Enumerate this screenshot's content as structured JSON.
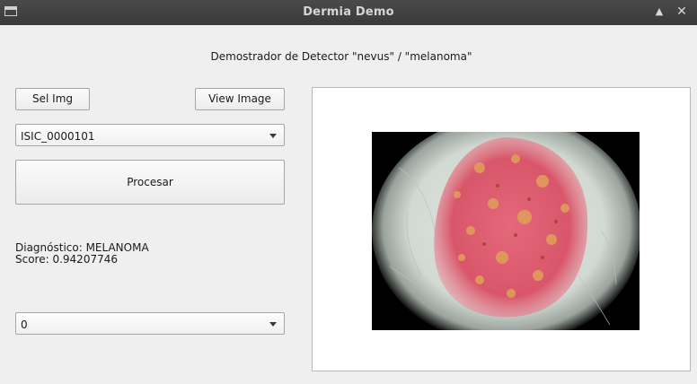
{
  "window": {
    "title": "Dermia Demo",
    "buttons": [
      "eject-icon",
      "close-icon"
    ]
  },
  "subtitle": "Demostrador de Detector \"nevus\" / \"melanoma\"",
  "controls": {
    "sel_img_label": "Sel Img",
    "view_image_label": "View Image",
    "image_select_value": "ISIC_0000101",
    "process_label": "Procesar",
    "index_select_value": "0"
  },
  "result": {
    "diagnosis": "Diagnóstico: MELANOMA",
    "score": "Score: 0.94207746"
  },
  "colors": {
    "titlebar": "#3f3f3f",
    "background": "#efefef",
    "panel": "#ffffff",
    "lesion": "#d9566a"
  }
}
